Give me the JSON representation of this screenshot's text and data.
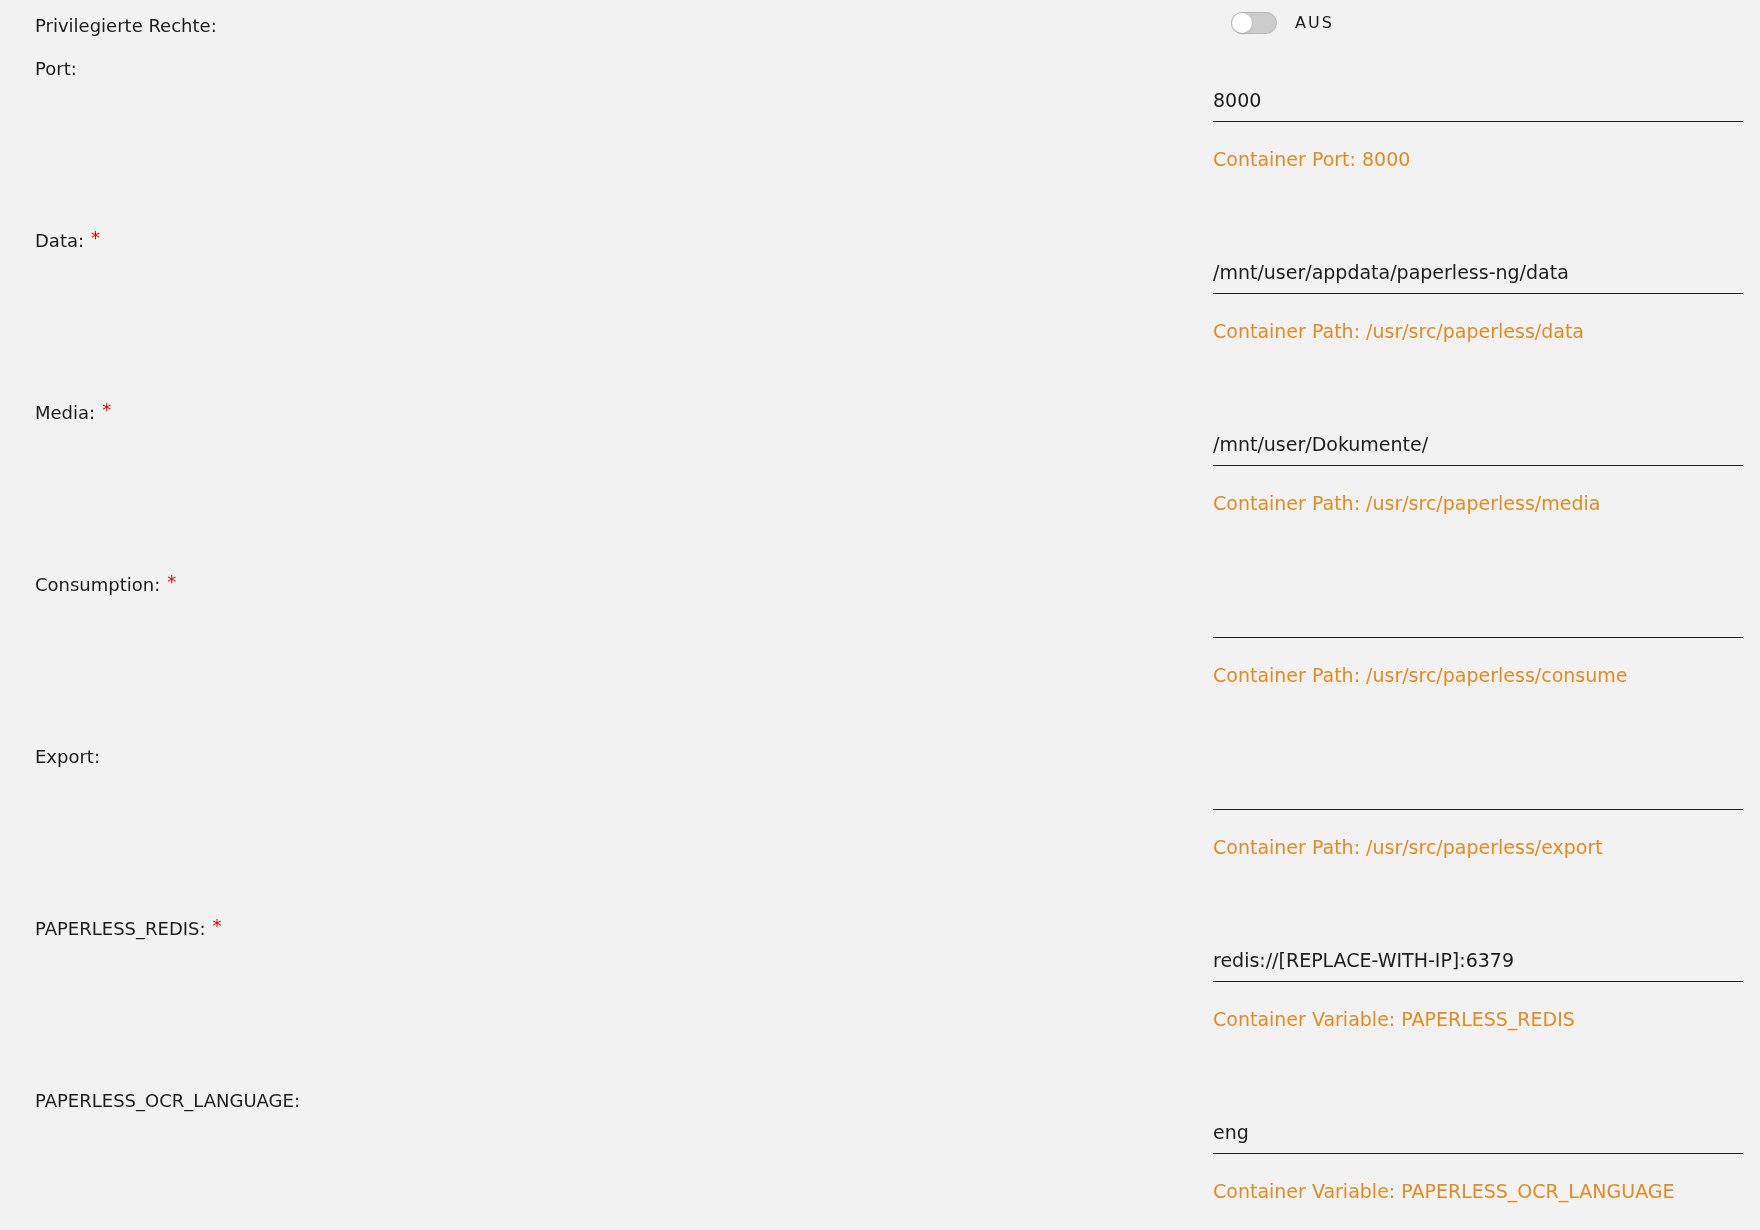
{
  "privileged": {
    "label": "Privilegierte Rechte:",
    "on": false,
    "state_text": "AUS"
  },
  "fields": [
    {
      "label": "Port:",
      "value": "8000",
      "hint": "Container Port: 8000"
    },
    {
      "label": "Data:",
      "required_mark": "*",
      "value": "/mnt/user/appdata/paperless-ng/data",
      "hint": "Container Path: /usr/src/paperless/data"
    },
    {
      "label": "Media:",
      "required_mark": "*",
      "value": "/mnt/user/Dokumente/",
      "hint": "Container Path: /usr/src/paperless/media"
    },
    {
      "label": "Consumption:",
      "required_mark": "*",
      "hint": "Container Path: /usr/src/paperless/consume"
    },
    {
      "label": "Export:",
      "hint": "Container Path: /usr/src/paperless/export"
    },
    {
      "label": "PAPERLESS_REDIS:",
      "required_mark": "*",
      "value": "redis://[REPLACE-WITH-IP]:6379",
      "hint": "Container Variable: PAPERLESS_REDIS"
    },
    {
      "label": "PAPERLESS_OCR_LANGUAGE:",
      "value": "eng",
      "hint": "Container Variable: PAPERLESS_OCR_LANGUAGE"
    }
  ]
}
